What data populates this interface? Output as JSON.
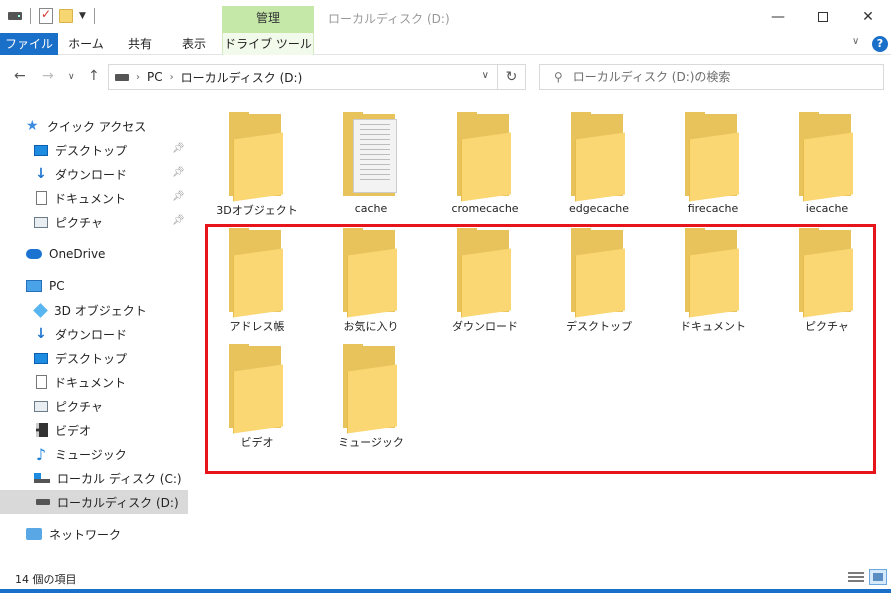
{
  "window": {
    "title": "ローカルディスク (D:)",
    "context_tab_title": "管理"
  },
  "ribbon": {
    "tabs": [
      "ファイル",
      "ホーム",
      "共有",
      "表示",
      "ドライブ ツール"
    ]
  },
  "address": {
    "crumbs": [
      "PC",
      "ローカルディスク (D:)"
    ]
  },
  "search": {
    "placeholder": "ローカルディスク (D:)の検索"
  },
  "sidebar": {
    "quick_access": "クイック アクセス",
    "quick_items": [
      "デスクトップ",
      "ダウンロード",
      "ドキュメント",
      "ピクチャ"
    ],
    "onedrive": "OneDrive",
    "pc": "PC",
    "pc_items": [
      "3D オブジェクト",
      "ダウンロード",
      "デスクトップ",
      "ドキュメント",
      "ピクチャ",
      "ビデオ",
      "ミュージック",
      "ローカル ディスク (C:)",
      "ローカルディスク (D:)"
    ],
    "network": "ネットワーク"
  },
  "files": [
    {
      "name": "3Dオブジェクト",
      "type": "folder"
    },
    {
      "name": "cache",
      "type": "folder-with-documents"
    },
    {
      "name": "cromecache",
      "type": "folder"
    },
    {
      "name": "edgecache",
      "type": "folder"
    },
    {
      "name": "firecache",
      "type": "folder"
    },
    {
      "name": "iecache",
      "type": "folder"
    },
    {
      "name": "アドレス帳",
      "type": "folder"
    },
    {
      "name": "お気に入り",
      "type": "folder"
    },
    {
      "name": "ダウンロード",
      "type": "folder"
    },
    {
      "name": "デスクトップ",
      "type": "folder"
    },
    {
      "name": "ドキュメント",
      "type": "folder"
    },
    {
      "name": "ピクチャ",
      "type": "folder"
    },
    {
      "name": "ビデオ",
      "type": "folder"
    },
    {
      "name": "ミュージック",
      "type": "folder"
    }
  ],
  "status": {
    "item_count": "14 個の項目"
  },
  "colors": {
    "accent": "#1a6fc9",
    "context_tab": "#c5e8a9",
    "highlight_box": "#e8141c",
    "folder": "#fad772"
  }
}
